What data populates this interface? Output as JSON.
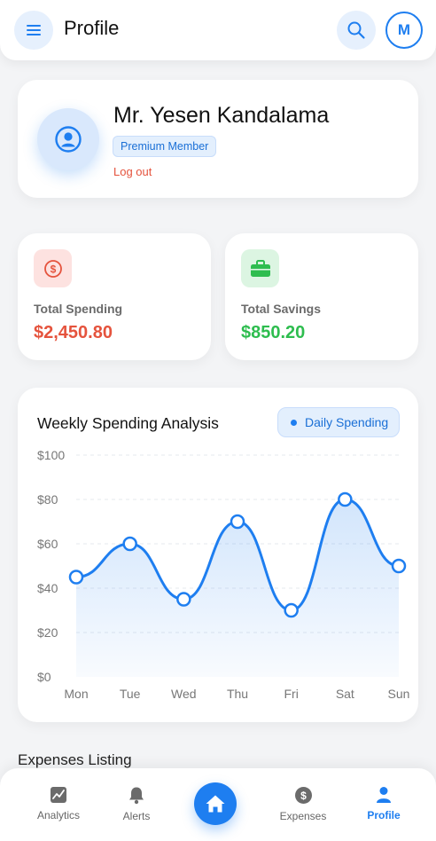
{
  "header": {
    "title": "Profile",
    "avatar_initial": "M"
  },
  "profile": {
    "name": "Mr. Yesen Kandalama",
    "badge": "Premium Member",
    "logout_label": "Log out"
  },
  "stats": {
    "spending": {
      "label": "Total Spending",
      "value": "$2,450.80"
    },
    "savings": {
      "label": "Total Savings",
      "value": "$850.20"
    }
  },
  "chart": {
    "title": "Weekly Spending Analysis",
    "legend_label": "Daily Spending"
  },
  "chart_data": {
    "type": "area",
    "title": "Weekly Spending Analysis",
    "categories": [
      "Mon",
      "Tue",
      "Wed",
      "Thu",
      "Fri",
      "Sat",
      "Sun"
    ],
    "series": [
      {
        "name": "Daily Spending",
        "values": [
          45,
          60,
          35,
          70,
          30,
          80,
          50
        ]
      }
    ],
    "ylim": [
      0,
      100
    ],
    "yticks": [
      0,
      20,
      40,
      60,
      80,
      100
    ],
    "ytick_labels": [
      "$0",
      "$20",
      "$40",
      "$60",
      "$80",
      "$100"
    ],
    "grid": true,
    "legend_position": "top-right",
    "color": "#1e7ef0"
  },
  "sections": {
    "expenses_title": "Expenses Listing"
  },
  "nav": {
    "analytics": "Analytics",
    "alerts": "Alerts",
    "expenses": "Expenses",
    "profile": "Profile"
  },
  "colors": {
    "accent": "#1e7ef0",
    "danger": "#e5533d",
    "success": "#2ebd4f"
  }
}
